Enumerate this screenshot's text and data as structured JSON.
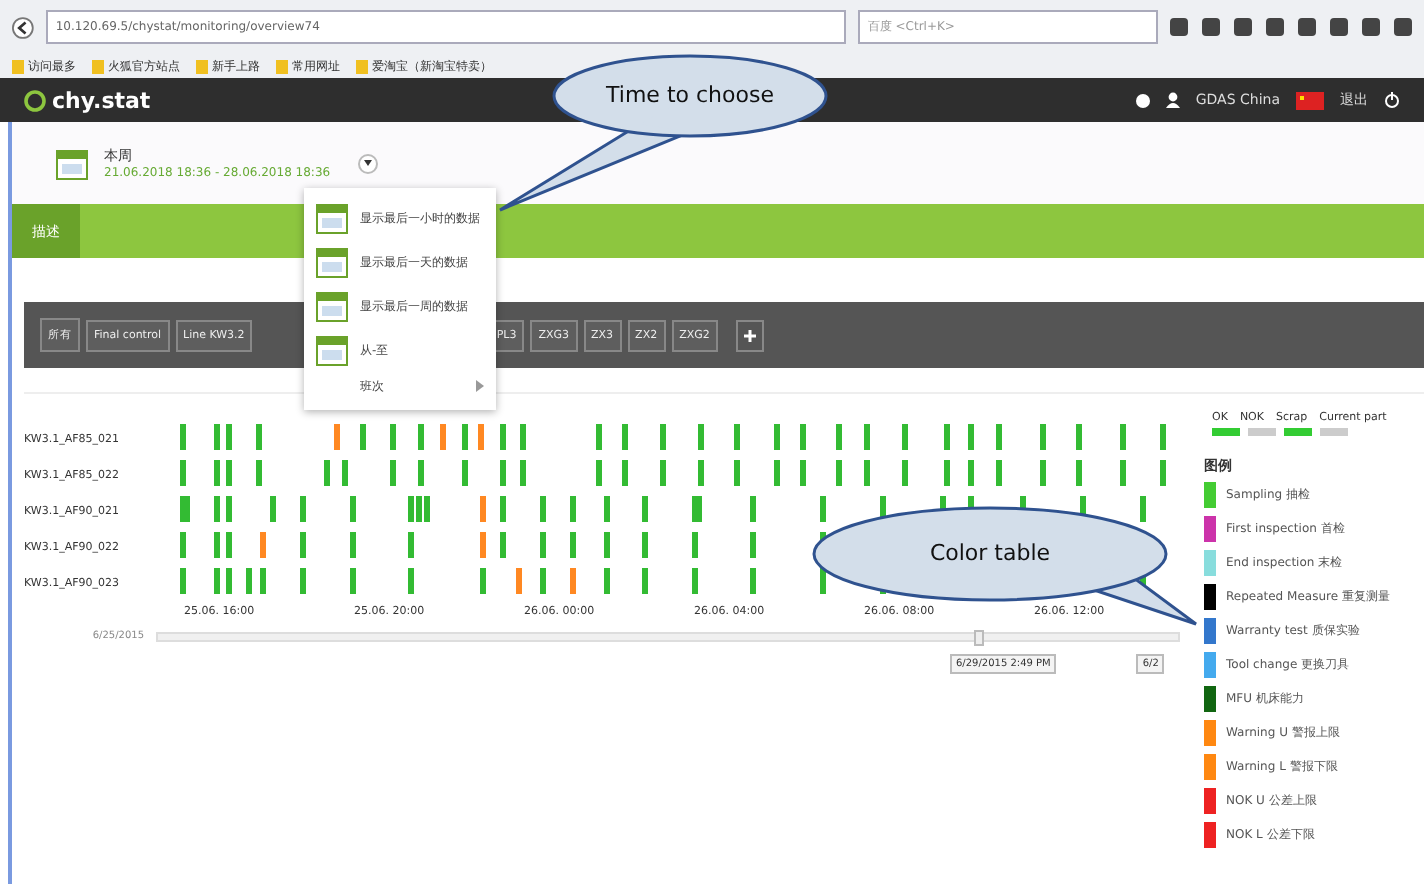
{
  "browser": {
    "url": "10.120.69.5/chystat/monitoring/overview74",
    "search_placeholder": "百度 <Ctrl+K>",
    "bookmarks": [
      "访问最多",
      "火狐官方站点",
      "新手上路",
      "常用网址",
      "爱淘宝（新淘宝特卖）"
    ]
  },
  "header": {
    "logo": "chy.stat",
    "user": "GDAS China",
    "logout": "退出"
  },
  "period": {
    "title": "本周",
    "range": "21.06.2018 18:36 - 28.06.2018 18:36"
  },
  "period_menu": {
    "items": [
      {
        "label": "显示最后一小时的数据",
        "kind": "calendar"
      },
      {
        "label": "显示最后一天的数据",
        "kind": "calendar"
      },
      {
        "label": "显示最后一周的数据",
        "kind": "calendar"
      },
      {
        "label": "从-至",
        "kind": "calendar"
      },
      {
        "label": "班次",
        "kind": "submenu"
      }
    ]
  },
  "tabs": [
    {
      "label": "描述",
      "selected": true
    }
  ],
  "filters": [
    "所有",
    "Final control",
    "Line KW3.2",
    "PL3",
    "ZXG3",
    "ZX3",
    "ZX2",
    "ZXG2"
  ],
  "timeline": {
    "rows": [
      "KW3.1_AF85_021",
      "KW3.1_AF85_022",
      "KW3.1_AF90_021",
      "KW3.1_AF90_022",
      "KW3.1_AF90_023"
    ],
    "ticks": [
      "25.06. 16:00",
      "25.06. 20:00",
      "26.06. 00:00",
      "26.06. 04:00",
      "26.06. 08:00",
      "26.06. 12:00"
    ],
    "range_start": "6/25/2015",
    "level": 0.8,
    "range_end_label": "6/29/2015 2:49 PM",
    "range_end_cut": "6/2"
  },
  "status_header": [
    {
      "label": "OK",
      "color": "#33cc33"
    },
    {
      "label": "NOK",
      "color": "#cccccc"
    },
    {
      "label": "Scrap",
      "color": "#33cc33"
    },
    {
      "label": "Current part",
      "color": "#cccccc"
    }
  ],
  "legend": {
    "title": "图例",
    "items": [
      {
        "label": "Sampling 抽检",
        "color": "#44cc33"
      },
      {
        "label": "First inspection 首检",
        "color": "#cc33aa"
      },
      {
        "label": "End inspection 末检",
        "color": "#88dddd"
      },
      {
        "label": "Repeated Measure 重复测量",
        "color": "#000000"
      },
      {
        "label": "Warranty test 质保实验",
        "color": "#3377cc"
      },
      {
        "label": "Tool change 更换刀具",
        "color": "#44aaee"
      },
      {
        "label": "MFU 机床能力",
        "color": "#116611"
      },
      {
        "label": "Warning U 警报上限",
        "color": "#ff8811"
      },
      {
        "label": "Warning L 警报下限",
        "color": "#ff8811"
      },
      {
        "label": "NOK U 公差上限",
        "color": "#ee2222"
      },
      {
        "label": "NOK L 公差下限",
        "color": "#ee2222"
      }
    ]
  },
  "callouts": [
    {
      "text": "Time to choose",
      "kind": "top"
    },
    {
      "text": "Color table",
      "kind": "right"
    }
  ]
}
